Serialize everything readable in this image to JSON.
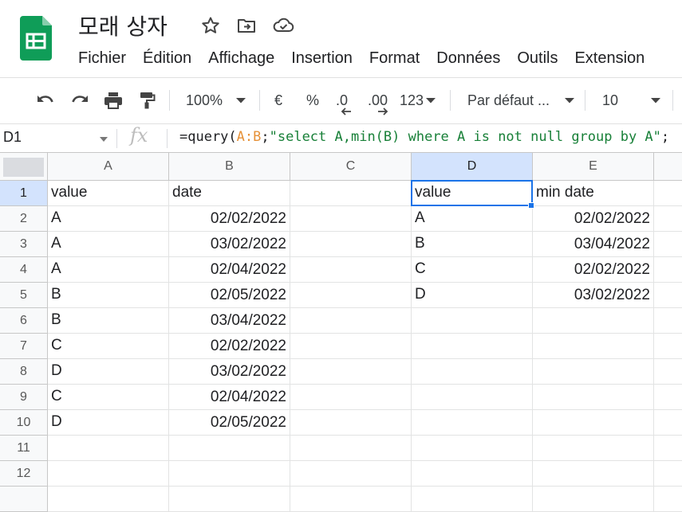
{
  "app": {
    "title": "모래 상자",
    "menu": [
      "Fichier",
      "Édition",
      "Affichage",
      "Insertion",
      "Format",
      "Données",
      "Outils",
      "Extension"
    ]
  },
  "toolbar": {
    "zoom": "100%",
    "currency": "€",
    "percent": "%",
    "decrease_decimals": ".0",
    "increase_decimals": ".00",
    "more_formats": "123",
    "font": "Par défaut ...",
    "font_size": "10"
  },
  "formula_bar": {
    "name_box": "D1",
    "fx": "fx",
    "formula_parts": {
      "prefix": "=query(",
      "range": "A:B",
      "semicolon": ";",
      "string": "\"select A,min(B) where A is not null group by A\"",
      "suffix": ";"
    }
  },
  "sheet": {
    "columns": [
      "A",
      "B",
      "C",
      "D",
      "E"
    ],
    "rows": [
      "1",
      "2",
      "3",
      "4",
      "5",
      "6",
      "7",
      "8",
      "9",
      "10",
      "11",
      "12"
    ],
    "cells": [
      [
        "value",
        "date",
        "",
        "value",
        "min date"
      ],
      [
        "A",
        "02/02/2022",
        "",
        "A",
        "02/02/2022"
      ],
      [
        "A",
        "03/02/2022",
        "",
        "B",
        "03/04/2022"
      ],
      [
        "A",
        "02/04/2022",
        "",
        "C",
        "02/02/2022"
      ],
      [
        "B",
        "02/05/2022",
        "",
        "D",
        "03/02/2022"
      ],
      [
        "B",
        "03/04/2022",
        "",
        "",
        ""
      ],
      [
        "C",
        "02/02/2022",
        "",
        "",
        ""
      ],
      [
        "D",
        "03/02/2022",
        "",
        "",
        ""
      ],
      [
        "C",
        "02/04/2022",
        "",
        "",
        ""
      ],
      [
        "D",
        "02/05/2022",
        "",
        "",
        ""
      ],
      [
        "",
        "",
        "",
        "",
        ""
      ],
      [
        "",
        "",
        "",
        "",
        ""
      ]
    ],
    "active_cell": "D1"
  },
  "colors": {
    "brand_green": "#0f9d58",
    "selection_blue": "#1a73e8",
    "formula_range": "#e69138",
    "formula_string": "#188038"
  }
}
